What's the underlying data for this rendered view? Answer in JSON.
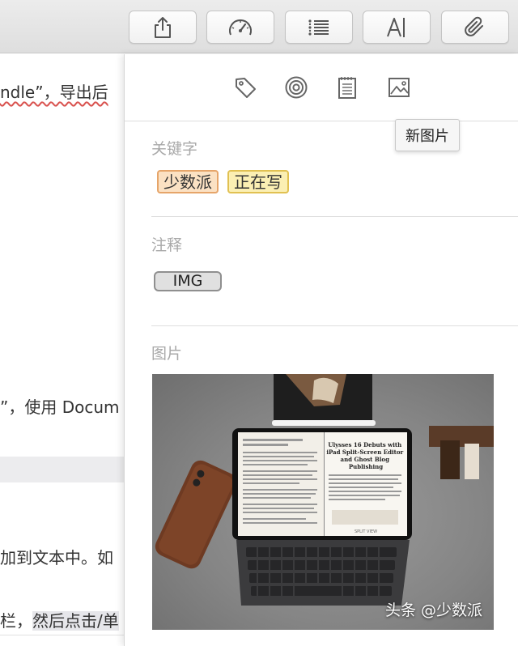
{
  "toolbar": {
    "buttons": [
      {
        "name": "share",
        "icon": "share-icon"
      },
      {
        "name": "stats",
        "icon": "gauge-icon"
      },
      {
        "name": "outline",
        "icon": "list-icon"
      },
      {
        "name": "typography",
        "icon": "text-cursor-icon"
      },
      {
        "name": "attachments",
        "icon": "paperclip-icon"
      }
    ]
  },
  "editor": {
    "line1": "ndle”，导出后",
    "line2": "”，使用 Docum",
    "line3": "加到文本中。如",
    "line4_pre": "栏，",
    "line4_hl": "然后点击/单"
  },
  "panel": {
    "tabs": [
      {
        "name": "keywords",
        "icon": "tag-icon"
      },
      {
        "name": "goals",
        "icon": "target-icon"
      },
      {
        "name": "notes",
        "icon": "notepad-icon"
      },
      {
        "name": "images",
        "icon": "image-icon"
      }
    ],
    "tooltip": "新图片",
    "keywords": {
      "title": "关键字",
      "items": [
        {
          "label": "少数派",
          "color": "#fbe1c3"
        },
        {
          "label": "正在写",
          "color": "#fbefb3"
        }
      ]
    },
    "notes": {
      "title": "注释",
      "pill": "IMG"
    },
    "images": {
      "title": "图片",
      "tablet_title": "Ulysses 16 Debuts with iPad Split-Screen Editor and Ghost Blog Publishing",
      "tablet_footer": "SPLIT VIEW"
    }
  },
  "watermark": "头条 @少数派"
}
